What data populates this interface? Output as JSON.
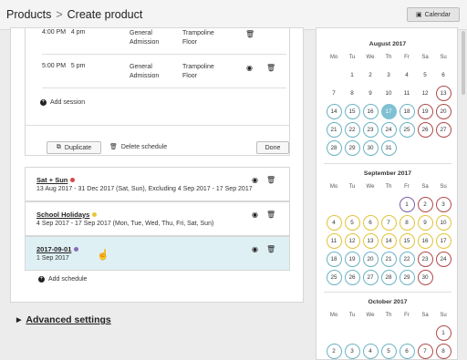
{
  "header": {
    "breadcrumb_parent": "Products",
    "breadcrumb_sep": ">",
    "breadcrumb_current": "Create product",
    "calendar_button": "Calendar"
  },
  "sessions": [
    {
      "time_a": "4:00 PM",
      "time_b": "4 pm",
      "admission": [
        "General",
        "Admission"
      ],
      "area": [
        "Trampoline",
        "Floor"
      ]
    },
    {
      "time_a": "5:00 PM",
      "time_b": "5 pm",
      "admission": [
        "General",
        "Admission"
      ],
      "area": [
        "Trampoline",
        "Floor"
      ]
    }
  ],
  "actions": {
    "add_session": "Add session",
    "duplicate": "Duplicate",
    "delete_schedule": "Delete schedule",
    "done": "Done",
    "add_schedule": "Add schedule"
  },
  "schedules": [
    {
      "name": "Sat + Sun",
      "color": "#d94848",
      "desc": "13 Aug 2017 - 31 Dec 2017 (Sat, Sun), Excluding 4 Sep 2017 - 17 Sep 2017"
    },
    {
      "name": "School Holidays",
      "color": "#e8c53a",
      "desc": "4 Sep 2017 - 17 Sep 2017 (Mon, Tue, Wed, Thu, Fri, Sat, Sun)"
    },
    {
      "name": "2017-09-01",
      "color": "#8a6bb5",
      "desc": "1 Sep 2017"
    }
  ],
  "advanced": "Advanced settings",
  "calendar": {
    "dow": [
      "Mo",
      "Tu",
      "We",
      "Th",
      "Fr",
      "Sa",
      "Su"
    ],
    "months": [
      {
        "title": "August 2017",
        "weeks": [
          [
            {
              "d": ""
            },
            {
              "d": "1"
            },
            {
              "d": "2"
            },
            {
              "d": "3"
            },
            {
              "d": "4"
            },
            {
              "d": "5"
            },
            {
              "d": "6"
            }
          ],
          [
            {
              "d": "7"
            },
            {
              "d": "8"
            },
            {
              "d": "9"
            },
            {
              "d": "10"
            },
            {
              "d": "11"
            },
            {
              "d": "12"
            },
            {
              "d": "13",
              "s": "red"
            }
          ],
          [
            {
              "d": "14",
              "s": "teal"
            },
            {
              "d": "15",
              "s": "teal"
            },
            {
              "d": "16",
              "s": "teal"
            },
            {
              "d": "17",
              "s": "selected"
            },
            {
              "d": "18",
              "s": "teal"
            },
            {
              "d": "19",
              "s": "red"
            },
            {
              "d": "20",
              "s": "red"
            }
          ],
          [
            {
              "d": "21",
              "s": "teal"
            },
            {
              "d": "22",
              "s": "teal"
            },
            {
              "d": "23",
              "s": "teal"
            },
            {
              "d": "24",
              "s": "teal"
            },
            {
              "d": "25",
              "s": "teal"
            },
            {
              "d": "26",
              "s": "red"
            },
            {
              "d": "27",
              "s": "red"
            }
          ],
          [
            {
              "d": "28",
              "s": "teal"
            },
            {
              "d": "29",
              "s": "teal"
            },
            {
              "d": "30",
              "s": "teal"
            },
            {
              "d": "31",
              "s": "teal"
            },
            {
              "d": ""
            },
            {
              "d": ""
            },
            {
              "d": ""
            }
          ]
        ]
      },
      {
        "title": "September 2017",
        "weeks": [
          [
            {
              "d": ""
            },
            {
              "d": ""
            },
            {
              "d": ""
            },
            {
              "d": ""
            },
            {
              "d": "1",
              "s": "purple"
            },
            {
              "d": "2",
              "s": "red"
            },
            {
              "d": "3",
              "s": "red"
            }
          ],
          [
            {
              "d": "4",
              "s": "yellow"
            },
            {
              "d": "5",
              "s": "yellow"
            },
            {
              "d": "6",
              "s": "yellow"
            },
            {
              "d": "7",
              "s": "yellow"
            },
            {
              "d": "8",
              "s": "yellow"
            },
            {
              "d": "9",
              "s": "yellow"
            },
            {
              "d": "10",
              "s": "yellow"
            }
          ],
          [
            {
              "d": "11",
              "s": "yellow"
            },
            {
              "d": "12",
              "s": "yellow"
            },
            {
              "d": "13",
              "s": "yellow"
            },
            {
              "d": "14",
              "s": "yellow"
            },
            {
              "d": "15",
              "s": "yellow"
            },
            {
              "d": "16",
              "s": "yellow"
            },
            {
              "d": "17",
              "s": "yellow"
            }
          ],
          [
            {
              "d": "18",
              "s": "teal"
            },
            {
              "d": "19",
              "s": "teal"
            },
            {
              "d": "20",
              "s": "teal"
            },
            {
              "d": "21",
              "s": "teal"
            },
            {
              "d": "22",
              "s": "teal"
            },
            {
              "d": "23",
              "s": "red"
            },
            {
              "d": "24",
              "s": "red"
            }
          ],
          [
            {
              "d": "25",
              "s": "teal"
            },
            {
              "d": "26",
              "s": "teal"
            },
            {
              "d": "27",
              "s": "teal"
            },
            {
              "d": "28",
              "s": "teal"
            },
            {
              "d": "29",
              "s": "teal"
            },
            {
              "d": "30",
              "s": "red"
            },
            {
              "d": ""
            }
          ]
        ]
      },
      {
        "title": "October 2017",
        "weeks": [
          [
            {
              "d": ""
            },
            {
              "d": ""
            },
            {
              "d": ""
            },
            {
              "d": ""
            },
            {
              "d": ""
            },
            {
              "d": ""
            },
            {
              "d": "1",
              "s": "red"
            }
          ],
          [
            {
              "d": "2",
              "s": "teal"
            },
            {
              "d": "3",
              "s": "teal"
            },
            {
              "d": "4",
              "s": "teal"
            },
            {
              "d": "5",
              "s": "teal"
            },
            {
              "d": "6",
              "s": "teal"
            },
            {
              "d": "7",
              "s": "red"
            },
            {
              "d": "8",
              "s": "red"
            }
          ]
        ]
      }
    ]
  }
}
